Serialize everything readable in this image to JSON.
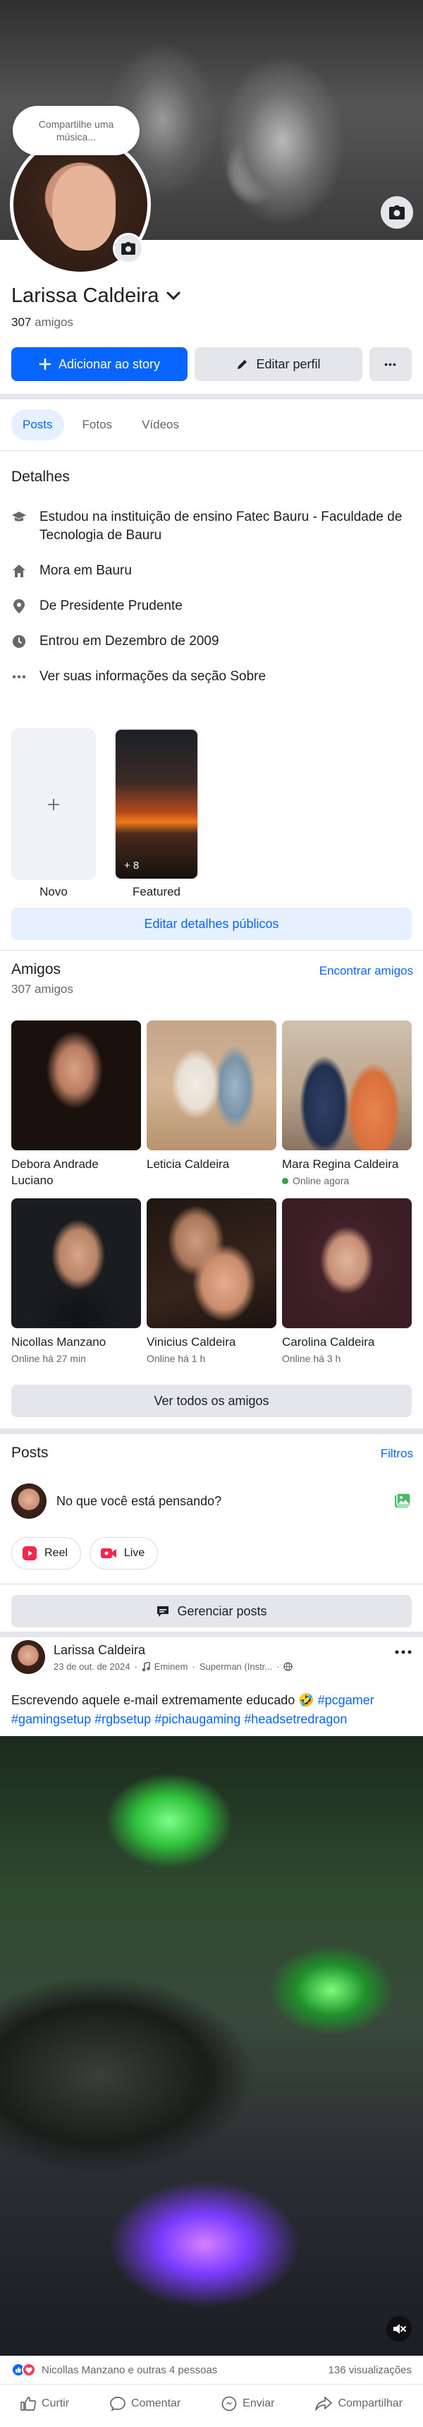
{
  "profile": {
    "music_bubble": "Compartilhe uma música...",
    "name": "Larissa Caldeira",
    "friends_count_number": "307",
    "friends_count_label": "amigos"
  },
  "actions": {
    "add_story": "Adicionar ao story",
    "edit_profile": "Editar perfil",
    "more": "•••"
  },
  "tabs": [
    "Posts",
    "Fotos",
    "Vídeos"
  ],
  "details": {
    "title": "Detalhes",
    "education_prefix": "Estudou na instituição de ensino ",
    "education_name": "Fatec Bauru - Faculdade de Tecnologia de Bauru",
    "lives_prefix": "Mora em ",
    "lives_city": "Bauru",
    "from_prefix": "De ",
    "from_city": "Presidente Prudente",
    "joined": "Entrou em Dezembro de 2009",
    "about": "Ver suas informações da seção Sobre"
  },
  "featured": {
    "new_label": "Novo",
    "featured_label": "Featured",
    "featured_count": "+ 8",
    "edit_public_details": "Editar detalhes públicos"
  },
  "friends": {
    "title": "Amigos",
    "count": "307 amigos",
    "find_friends": "Encontrar amigos",
    "see_all": "Ver todos os amigos",
    "items": [
      {
        "name": "Debora Andrade Luciano",
        "status": ""
      },
      {
        "name": "Leticia Caldeira",
        "status": ""
      },
      {
        "name": "Mara Regina Caldeira",
        "status": "Online agora"
      },
      {
        "name": "Nicollas Manzano",
        "status": "Online há 27 min"
      },
      {
        "name": "Vinicius Caldeira",
        "status": "Online há 1 h"
      },
      {
        "name": "Carolina Caldeira",
        "status": "Online há 3 h"
      }
    ]
  },
  "posts_section": {
    "title": "Posts",
    "filters": "Filtros",
    "composer_placeholder": "No que você está pensando?",
    "reel": "Reel",
    "live": "Live",
    "manage_posts": "Gerenciar posts"
  },
  "post": {
    "author": "Larissa Caldeira",
    "date": "23 de out. de 2024",
    "music": "Eminem",
    "music_track": "Superman (Instr...",
    "text_prefix": "Escrevendo aquele e-mail extremamente educado 🤣 ",
    "hashtags": [
      "#pcgamer",
      "#gamingsetup",
      "#rgbsetup",
      "#pichaugaming",
      "#headsetredragon"
    ],
    "reactions_text": "Nicollas Manzano e outras 4 pessoas",
    "views": "136 visualizações",
    "like": "Curtir",
    "comment": "Comentar",
    "send": "Enviar",
    "share": "Compartilhar"
  },
  "colors": {
    "brand_blue": "#0866ff",
    "online_green": "#31a24c",
    "love_red": "#f33e58"
  }
}
